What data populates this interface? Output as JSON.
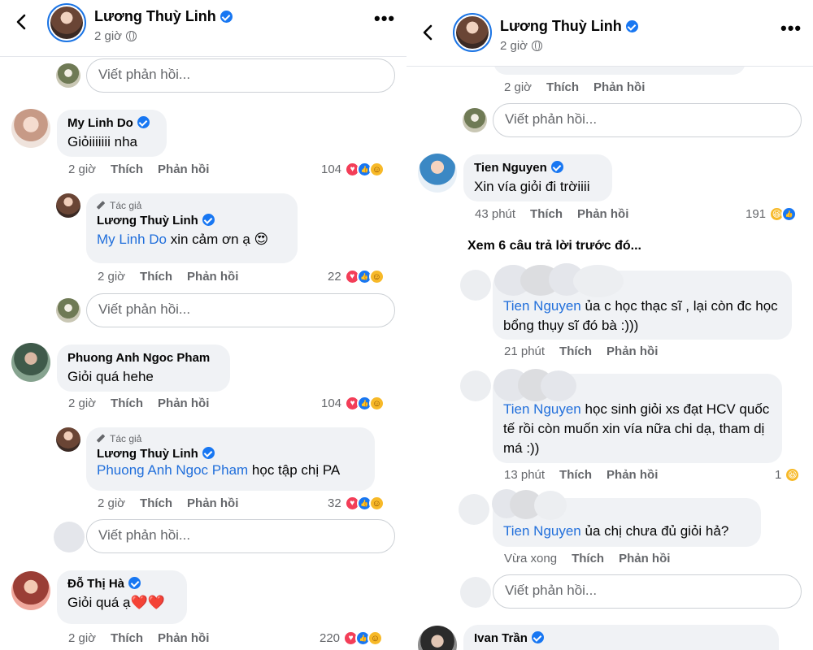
{
  "left": {
    "header": {
      "name": "Lương Thuỳ Linh",
      "time": "2 giờ"
    },
    "reply_placeholder": "Viết phản hồi...",
    "comments": [
      {
        "name": "My Linh Do",
        "text": "Giỏiiiiiii nha",
        "time": "2 giờ",
        "like": "Thích",
        "reply": "Phản hồi",
        "count": "104"
      },
      {
        "author_label": "Tác giả",
        "name": "Lương Thuỳ Linh",
        "tag": "My Linh Do",
        "text": " xin cảm ơn ạ ",
        "emoji": "😍",
        "time": "2 giờ",
        "like": "Thích",
        "reply": "Phản hồi",
        "count": "22"
      },
      {
        "name": "Phuong Anh Ngoc Pham",
        "text": "Giỏi quá hehe",
        "time": "2 giờ",
        "like": "Thích",
        "reply": "Phản hồi",
        "count": "104"
      },
      {
        "author_label": "Tác giả",
        "name": "Lương Thuỳ Linh",
        "tag": "Phuong Anh Ngoc Pham",
        "text": " học tập chị PA",
        "time": "2 giờ",
        "like": "Thích",
        "reply": "Phản hồi",
        "count": "32"
      },
      {
        "name": "Đỗ Thị Hà",
        "text": "Giỏi quá ạ",
        "emoji": "❤️❤️",
        "time": "2 giờ",
        "like": "Thích",
        "reply": "Phản hồi",
        "count": "220"
      }
    ]
  },
  "right": {
    "header": {
      "name": "Lương Thuỳ Linh",
      "time": "2 giờ"
    },
    "reply_placeholder": "Viết phản hồi...",
    "top_meta": {
      "time": "2 giờ",
      "like": "Thích",
      "reply": "Phản hồi"
    },
    "comments": [
      {
        "name": "Tien Nguyen",
        "text": "Xin vía giỏi đi trờiiii",
        "time": "43 phút",
        "like": "Thích",
        "reply": "Phản hồi",
        "count": "191"
      },
      {
        "tag": "Tien Nguyen",
        "text": " ủa c học  thạc sĩ , lại còn đc học bổng thụy sĩ đó bà :)))",
        "time": "21 phút",
        "like": "Thích",
        "reply": "Phản hồi"
      },
      {
        "tag": "Tien Nguyen",
        "text": " học sinh giỏi xs đạt HCV quốc tế rồi còn muốn xin vía nữa chi dạ, tham dị má :))",
        "time": "13 phút",
        "like": "Thích",
        "reply": "Phản hồi",
        "count": "1"
      },
      {
        "tag": "Tien Nguyen",
        "text": " ủa chị chưa đủ giỏi hả?",
        "time": "Vừa xong",
        "like": "Thích",
        "reply": "Phản hồi"
      },
      {
        "name": "Ivan Trần"
      }
    ],
    "view_previous": "Xem 6 câu trả lời trước đó..."
  },
  "colors": {
    "link": "#216fdb",
    "verified": "#1877f2",
    "bubble": "#f0f2f5",
    "meta": "#65676b"
  },
  "icons": [
    "back-arrow-icon",
    "globe-icon",
    "more-dots-icon",
    "verified-icon",
    "heart-reaction-icon",
    "like-reaction-icon",
    "care-reaction-icon",
    "haha-reaction-icon",
    "pen-icon"
  ]
}
